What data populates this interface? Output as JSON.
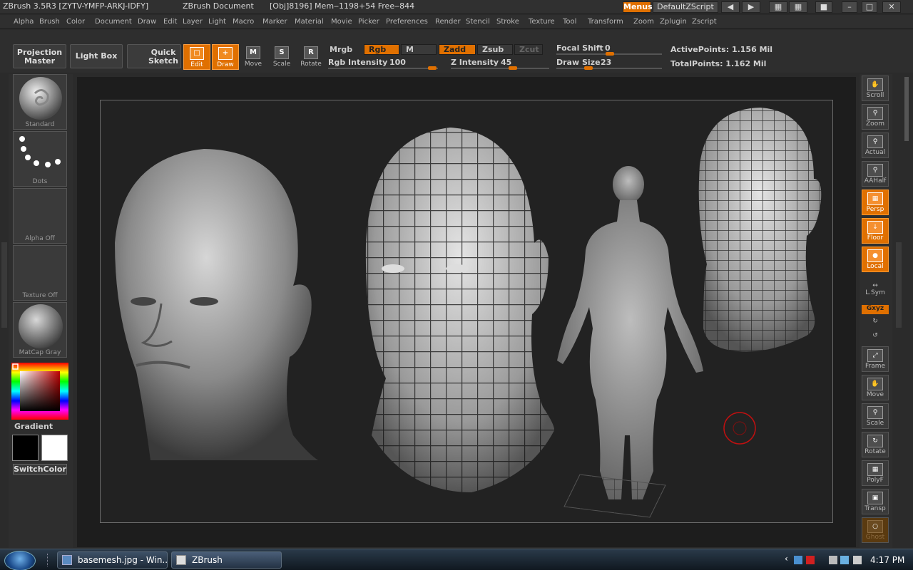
{
  "titlebar": {
    "app": "ZBrush 3.5R3 [ZYTV-YMFP-ARKJ-IDFY]",
    "document": "ZBrush Document",
    "stats": "[Obj]8196] Mem‒1198+54 Free‒844",
    "menus_label": "Menus",
    "script_label": "DefaultZScript"
  },
  "menubar": {
    "items": [
      "Alpha",
      "Brush",
      "Color",
      "Document",
      "Draw",
      "Edit",
      "Layer",
      "Light",
      "Macro",
      "Marker",
      "Material",
      "Movie",
      "Picker",
      "Preferences",
      "Render",
      "Stencil",
      "Stroke",
      "Texture",
      "Tool",
      "Transform",
      "Zoom",
      "Zplugin",
      "Zscript"
    ]
  },
  "toolbar": {
    "projection_master": "Projection Master",
    "light_box": "Light Box",
    "quick_sketch": "Quick Sketch",
    "edit": "Edit",
    "draw": "Draw",
    "move": "Move",
    "scale": "Scale",
    "rotate": "Rotate",
    "move_icon": "M",
    "scale_icon": "S",
    "rotate_icon": "R",
    "mrgb": "Mrgb",
    "rgb": "Rgb",
    "m": "M",
    "zadd": "Zadd",
    "zsub": "Zsub",
    "zcut": "Zcut",
    "rgb_intensity_label": "Rgb Intensity",
    "rgb_intensity": "100",
    "z_intensity_label": "Z Intensity",
    "z_intensity": "45",
    "focal_shift_label": "Focal Shift",
    "focal_shift": "0",
    "draw_size_label": "Draw Size",
    "draw_size": "23",
    "active_points": "ActivePoints: 1.156 Mil",
    "total_points": "TotalPoints: 1.162 Mil"
  },
  "leftshelf": {
    "brush": "Standard",
    "stroke": "Dots",
    "alpha": "Alpha Off",
    "texture": "Texture Off",
    "material": "MatCap Gray",
    "gradient": "Gradient",
    "switch_color": "SwitchColor",
    "main_color": "#000000",
    "secondary_color": "#ffffff"
  },
  "rightshelf": {
    "scroll": "Scroll",
    "zoom": "Zoom",
    "actual": "Actual",
    "aahalf": "AAHalf",
    "persp": "Persp",
    "floor": "Floor",
    "local": "Local",
    "lsym": "L.Sym",
    "xyz": "Gxyz",
    "frame": "Frame",
    "move": "Move",
    "scale": "Scale",
    "rotate": "Rotate",
    "polyf": "PolyF",
    "transp": "Transp",
    "ghost": "Ghost"
  },
  "taskbar": {
    "task1": "basemesh.jpg - Win...",
    "task2": "ZBrush",
    "clock": "4:17 PM"
  },
  "colors": {
    "accent": "#e07000",
    "canvas": "#1d1d1d",
    "panel": "#2e2e2e"
  }
}
